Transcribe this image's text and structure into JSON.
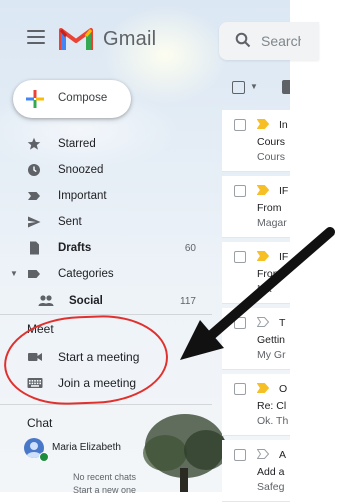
{
  "app": {
    "name": "Gmail"
  },
  "search": {
    "placeholder": "Search"
  },
  "compose": {
    "label": "Compose"
  },
  "nav": [
    {
      "label": "Starred",
      "icon": "star-icon"
    },
    {
      "label": "Snoozed",
      "icon": "clock-icon"
    },
    {
      "label": "Important",
      "icon": "label-important-icon"
    },
    {
      "label": "Sent",
      "icon": "send-icon"
    },
    {
      "label": "Drafts",
      "icon": "draft-icon",
      "count": "60"
    },
    {
      "label": "Categories",
      "icon": "label-icon"
    },
    {
      "label": "Social",
      "icon": "people-icon",
      "count": "117"
    }
  ],
  "meet": {
    "title": "Meet",
    "items": [
      {
        "label": "Start a meeting",
        "icon": "videocam-icon"
      },
      {
        "label": "Join a meeting",
        "icon": "keyboard-icon"
      }
    ]
  },
  "chat": {
    "title": "Chat",
    "user": "Maria Elizabeth",
    "empty_line1": "No recent chats",
    "empty_line2": "Start a new one"
  },
  "emails": [
    {
      "sender": "In",
      "line1": "Cours",
      "line2": "Cours"
    },
    {
      "sender": "IF",
      "line1": "From",
      "line2": "Magar"
    },
    {
      "sender": "IF",
      "line1": "From",
      "line2": "Ma"
    },
    {
      "sender": "T",
      "line1": "Gettin",
      "line2": "My Gr"
    },
    {
      "sender": "O",
      "line1": "Re: Cl",
      "line2": "Ok. Th"
    },
    {
      "sender": "A",
      "line1": "Add a",
      "line2": "Safeg"
    }
  ],
  "colors": {
    "annotation": "#e0312f",
    "important_marker": "#f6bf26",
    "online": "#1e8e3e"
  }
}
